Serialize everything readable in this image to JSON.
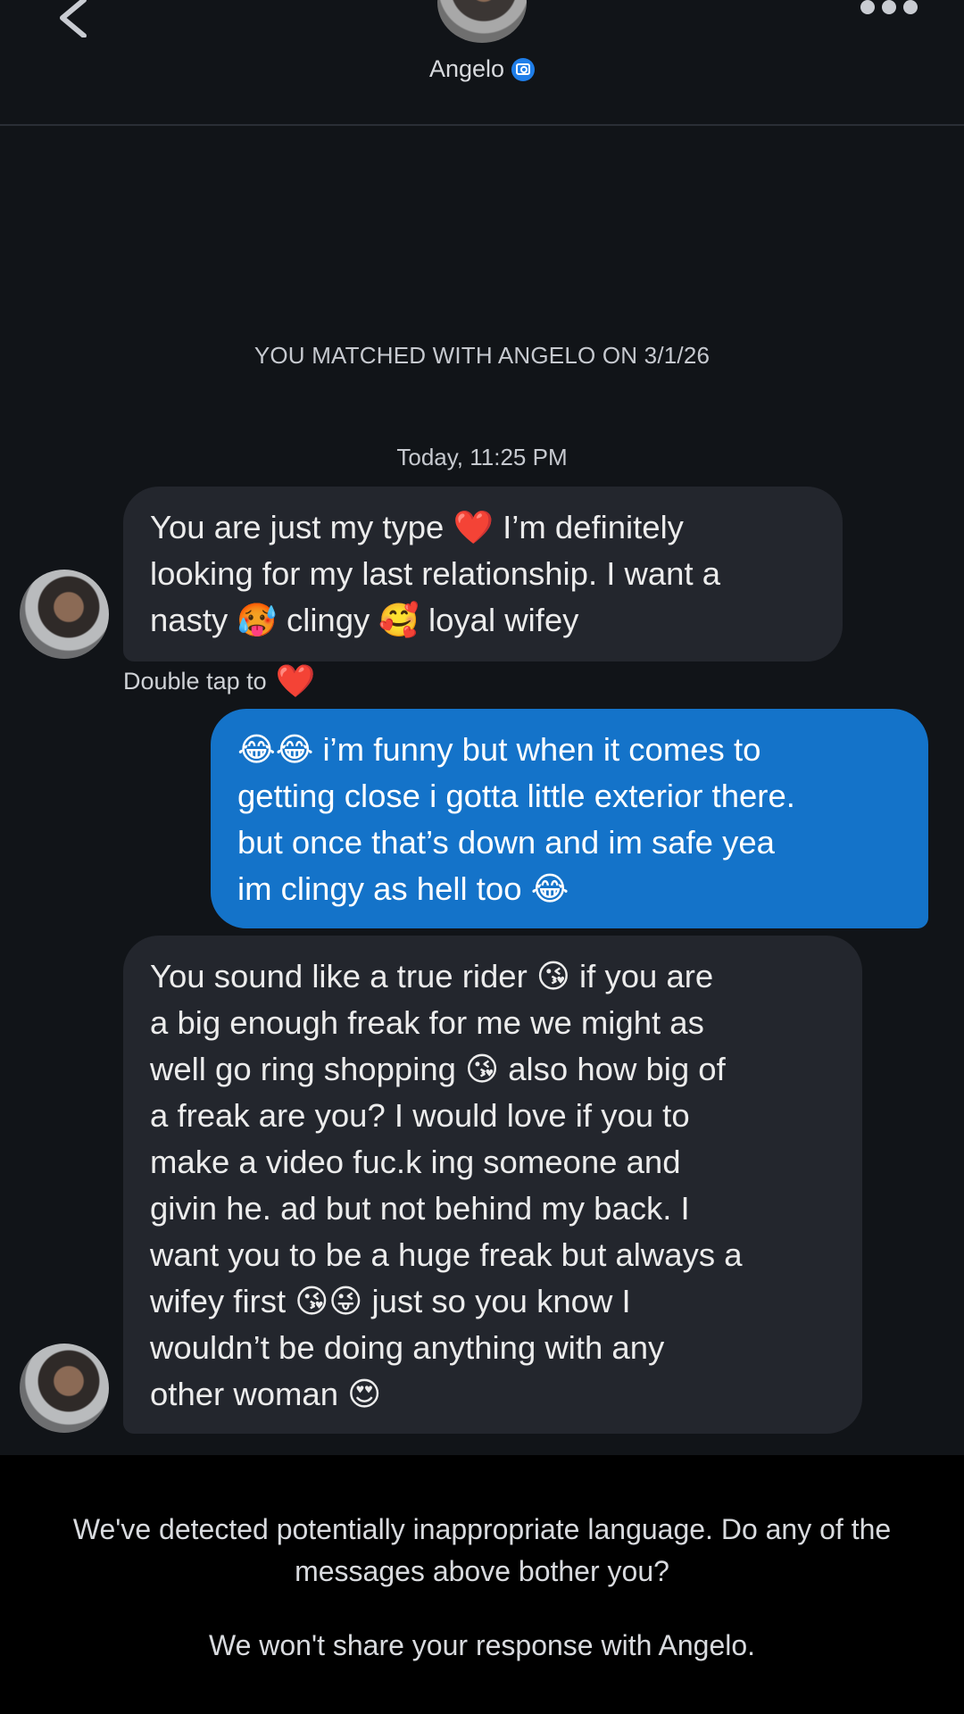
{
  "header": {
    "name": "Angelo",
    "verified_icon": "camera-verified-icon"
  },
  "match_banner": "YOU MATCHED WITH ANGELO ON 3/1/26",
  "timestamp": "Today, 11:25 PM",
  "messages": [
    {
      "direction": "incoming",
      "text": "You are just my type ❤️ I’m definitely\nlooking for my last relationship. I want a\nnasty 🥵 clingy 🥰 loyal wifey"
    },
    {
      "direction": "outgoing",
      "text": "😂😂 i’m funny but when it comes to\ngetting close i gotta little exterior there.\nbut once that’s down and im safe yea\nim clingy as hell too 😂"
    },
    {
      "direction": "incoming",
      "text": "You sound like a true rider 😘 if you are\na big enough freak for me we might as\nwell go ring shopping 😘 also how big of\na freak are you? I would love if you to\nmake a video fuc.k ing someone and\ngivin he. ad but not behind my back. I\nwant you to be a huge freak but always a\nwifey first 😘😜 just so you know I\nwouldn’t be doing anything with any\nother woman 😍"
    }
  ],
  "double_tap": {
    "label": "Double tap to",
    "heart": "❤️"
  },
  "footer": {
    "warning": "We've detected potentially inappropriate language. Do any of the messages above bother you?",
    "privacy": "We won't share your response with Angelo."
  }
}
